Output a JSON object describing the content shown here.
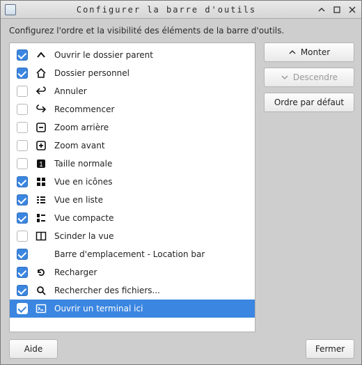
{
  "window": {
    "title": "Configurer la barre d'outils"
  },
  "description": "Configurez l'ordre et la visibilité des éléments de la barre d'outils.",
  "buttons": {
    "up": "Monter",
    "down": "Descendre",
    "reset": "Ordre par défaut",
    "help": "Aide",
    "close": "Fermer"
  },
  "items": [
    {
      "id": "parent-folder",
      "label": "Ouvrir le dossier parent",
      "checked": true,
      "icon": "chevron-up"
    },
    {
      "id": "home",
      "label": "Dossier personnel",
      "checked": true,
      "icon": "home"
    },
    {
      "id": "undo",
      "label": "Annuler",
      "checked": false,
      "icon": "arrow-left-curve"
    },
    {
      "id": "redo",
      "label": "Recommencer",
      "checked": false,
      "icon": "arrow-right-curve"
    },
    {
      "id": "zoom-out",
      "label": "Zoom arrière",
      "checked": false,
      "icon": "zoom-out"
    },
    {
      "id": "zoom-in",
      "label": "Zoom avant",
      "checked": false,
      "icon": "zoom-in"
    },
    {
      "id": "normal-size",
      "label": "Taille normale",
      "checked": false,
      "icon": "one-square"
    },
    {
      "id": "icon-view",
      "label": "Vue en icônes",
      "checked": true,
      "icon": "grid"
    },
    {
      "id": "list-view",
      "label": "Vue en liste",
      "checked": true,
      "icon": "list"
    },
    {
      "id": "compact-view",
      "label": "Vue compacte",
      "checked": true,
      "icon": "compact"
    },
    {
      "id": "split-view",
      "label": "Scinder la vue",
      "checked": false,
      "icon": "split"
    },
    {
      "id": "location-bar",
      "label": "Barre d'emplacement - Location bar",
      "checked": true,
      "icon": ""
    },
    {
      "id": "reload",
      "label": "Recharger",
      "checked": true,
      "icon": "reload"
    },
    {
      "id": "search",
      "label": "Rechercher des fichiers...",
      "checked": true,
      "icon": "search"
    },
    {
      "id": "terminal",
      "label": "Ouvrir un terminal ici",
      "checked": true,
      "icon": "terminal",
      "selected": true
    }
  ]
}
